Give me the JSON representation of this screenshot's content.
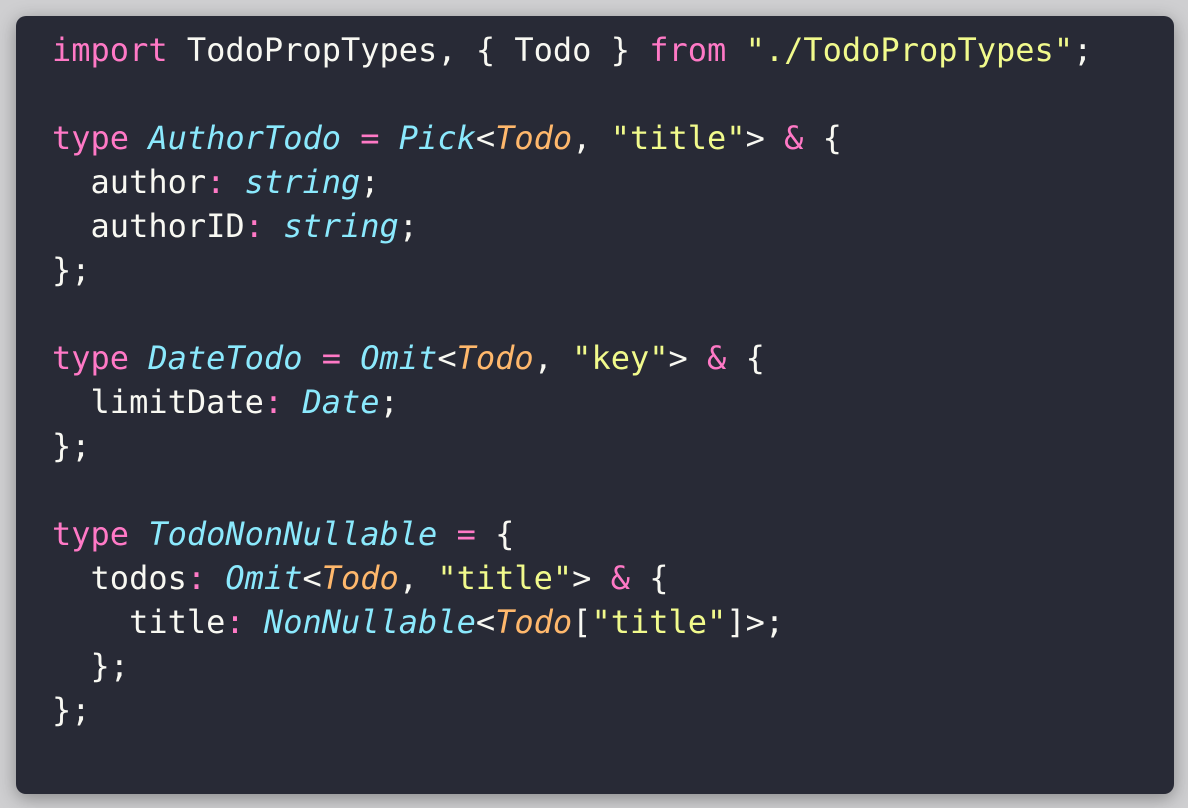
{
  "colors": {
    "background": "#282a36",
    "text": "#f8f8f2",
    "keyword": "#ff79c6",
    "type": "#8be9fd",
    "generic_arg": "#ffb86c",
    "string": "#f1fa8c"
  },
  "lines": [
    [
      [
        "kw",
        "import"
      ],
      [
        "pl",
        " TodoPropTypes, { Todo } "
      ],
      [
        "kw",
        "from"
      ],
      [
        "pl",
        " "
      ],
      [
        "str",
        "\"./TodoPropTypes\""
      ],
      [
        "pl",
        ";"
      ]
    ],
    [],
    [
      [
        "kw",
        "type"
      ],
      [
        "pl",
        " "
      ],
      [
        "ty",
        "AuthorTodo"
      ],
      [
        "pl",
        " "
      ],
      [
        "op",
        "="
      ],
      [
        "pl",
        " "
      ],
      [
        "ty",
        "Pick"
      ],
      [
        "pl",
        "<"
      ],
      [
        "gen",
        "Todo"
      ],
      [
        "pl",
        ", "
      ],
      [
        "str",
        "\"title\""
      ],
      [
        "pl",
        "> "
      ],
      [
        "op",
        "&"
      ],
      [
        "pl",
        " {"
      ]
    ],
    [
      [
        "pl",
        "  author"
      ],
      [
        "op",
        ":"
      ],
      [
        "pl",
        " "
      ],
      [
        "ty",
        "string"
      ],
      [
        "pl",
        ";"
      ]
    ],
    [
      [
        "pl",
        "  authorID"
      ],
      [
        "op",
        ":"
      ],
      [
        "pl",
        " "
      ],
      [
        "ty",
        "string"
      ],
      [
        "pl",
        ";"
      ]
    ],
    [
      [
        "pl",
        "};"
      ]
    ],
    [],
    [
      [
        "kw",
        "type"
      ],
      [
        "pl",
        " "
      ],
      [
        "ty",
        "DateTodo"
      ],
      [
        "pl",
        " "
      ],
      [
        "op",
        "="
      ],
      [
        "pl",
        " "
      ],
      [
        "ty",
        "Omit"
      ],
      [
        "pl",
        "<"
      ],
      [
        "gen",
        "Todo"
      ],
      [
        "pl",
        ", "
      ],
      [
        "str",
        "\"key\""
      ],
      [
        "pl",
        "> "
      ],
      [
        "op",
        "&"
      ],
      [
        "pl",
        " {"
      ]
    ],
    [
      [
        "pl",
        "  limitDate"
      ],
      [
        "op",
        ":"
      ],
      [
        "pl",
        " "
      ],
      [
        "ty",
        "Date"
      ],
      [
        "pl",
        ";"
      ]
    ],
    [
      [
        "pl",
        "};"
      ]
    ],
    [],
    [
      [
        "kw",
        "type"
      ],
      [
        "pl",
        " "
      ],
      [
        "ty",
        "TodoNonNullable"
      ],
      [
        "pl",
        " "
      ],
      [
        "op",
        "="
      ],
      [
        "pl",
        " {"
      ]
    ],
    [
      [
        "pl",
        "  todos"
      ],
      [
        "op",
        ":"
      ],
      [
        "pl",
        " "
      ],
      [
        "ty",
        "Omit"
      ],
      [
        "pl",
        "<"
      ],
      [
        "gen",
        "Todo"
      ],
      [
        "pl",
        ", "
      ],
      [
        "str",
        "\"title\""
      ],
      [
        "pl",
        "> "
      ],
      [
        "op",
        "&"
      ],
      [
        "pl",
        " {"
      ]
    ],
    [
      [
        "pl",
        "    title"
      ],
      [
        "op",
        ":"
      ],
      [
        "pl",
        " "
      ],
      [
        "ty",
        "NonNullable"
      ],
      [
        "pl",
        "<"
      ],
      [
        "gen",
        "Todo"
      ],
      [
        "pl",
        "["
      ],
      [
        "str",
        "\"title\""
      ],
      [
        "pl",
        "]>;"
      ]
    ],
    [
      [
        "pl",
        "  };"
      ]
    ],
    [
      [
        "pl",
        "};"
      ]
    ]
  ]
}
